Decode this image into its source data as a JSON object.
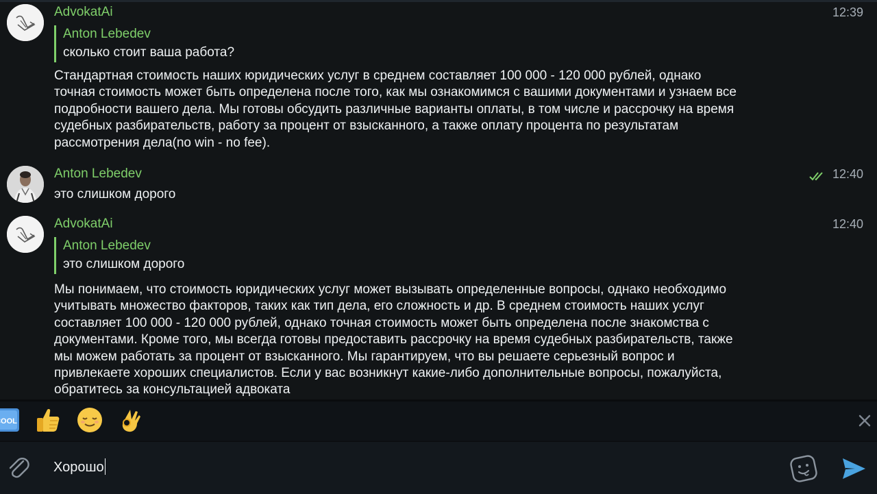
{
  "colors": {
    "accent": "#7fcf6a",
    "background": "#121517",
    "send": "#4aa3e0"
  },
  "messages": [
    {
      "avatar_icon": "swan-logo-icon",
      "sender": "AdvokatAi",
      "time": "12:39",
      "reply": {
        "name": "Anton Lebedev",
        "text": "сколько стоит ваша работа?"
      },
      "text": "Стандартная стоимость наших юридических услуг в среднем составляет 100 000 - 120 000 рублей, однако точная стоимость может быть определена после того, как мы ознакомимся с вашими документами и узнаем все подробности вашего дела. Мы готовы обсудить различные варианты оплаты, в том числе и рассрочку на время судебных разбирательств, работу за процент от взысканного, а также оплату процента по результатам рассмотрения дела(no win - no fee)."
    },
    {
      "avatar_icon": "user-photo-icon",
      "sender": "Anton Lebedev",
      "time": "12:40",
      "status_icon": "double-check-icon",
      "text": "это слишком дорого"
    },
    {
      "avatar_icon": "swan-logo-icon",
      "sender": "AdvokatAi",
      "time": "12:40",
      "reply": {
        "name": "Anton Lebedev",
        "text": "это слишком дорого"
      },
      "text": "Мы понимаем, что стоимость юридических услуг может вызывать определенные вопросы, однако необходимо учитывать множество факторов, таких как тип дела, его сложность и др. В среднем стоимость наших услуг составляет 100 000 - 120 000 рублей, однако точная стоимость может быть определена после знакомства с документами. Кроме того, мы всегда готовы предоставить рассрочку на время судебных разбирательств, также мы можем работать за процент от взысканного. Мы гарантируем, что вы решаете серьезный вопрос и привлекаете хороших специалистов. Если у вас возникнут какие-либо дополнительные вопросы, пожалуйста, обратитесь за консультацией адвоката"
    }
  ],
  "emoji_suggestions": {
    "items": [
      {
        "icon": "cool-emoji-icon",
        "text": "COOL"
      },
      {
        "icon": "thumbs-up-emoji-icon"
      },
      {
        "icon": "relieved-face-emoji-icon"
      },
      {
        "icon": "ok-hand-emoji-icon"
      }
    ],
    "close_icon": "close-icon"
  },
  "composer": {
    "attach_icon": "paperclip-icon",
    "value": "Хорошо",
    "sticker_icon": "sticker-icon",
    "send_icon": "send-icon"
  }
}
